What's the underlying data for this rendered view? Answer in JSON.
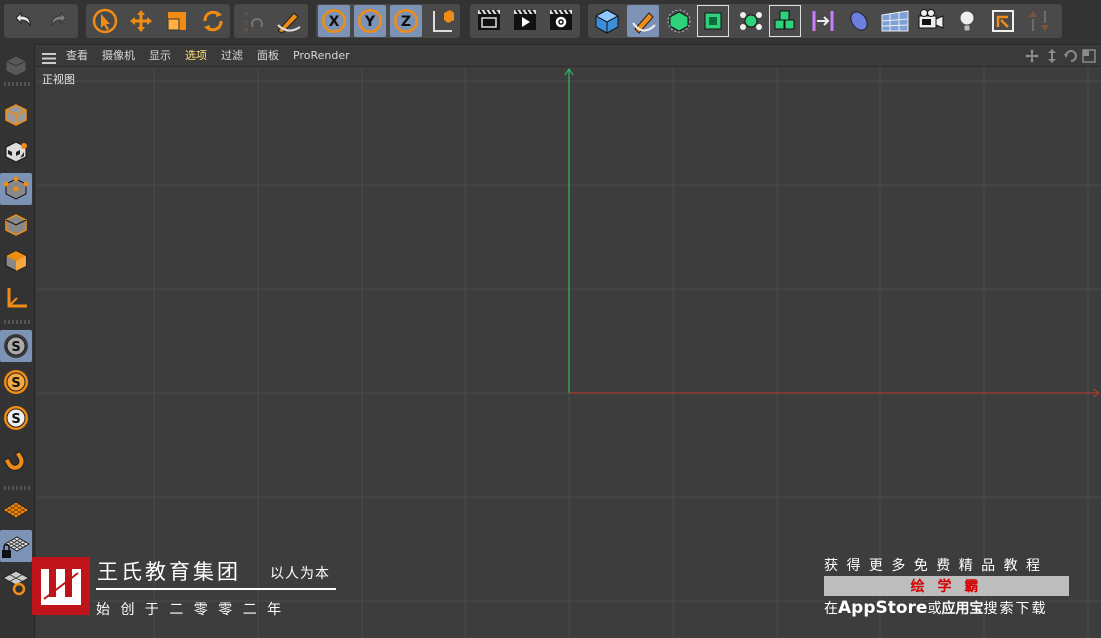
{
  "viewport_menu": {
    "items": [
      "查看",
      "摄像机",
      "显示",
      "选项",
      "过滤",
      "面板",
      "ProRender"
    ],
    "active_item": "选项",
    "view_name": "正视图"
  },
  "toolbar_icons": [
    "undo-icon",
    "redo-icon",
    "select-tool-icon",
    "move-tool-icon",
    "scale-tool-icon",
    "rotate-tool-icon",
    "psr-icon",
    "recent-tool-icon",
    "x-axis-icon",
    "y-axis-icon",
    "z-axis-icon",
    "coordinate-system-icon",
    "render-region-icon",
    "render-view-icon",
    "render-settings-icon",
    "cube-icon",
    "pen-icon",
    "subdivision-icon",
    "array-icon",
    "mograph-cloner-icon",
    "bend-deformer-icon",
    "capsule-icon",
    "floor-icon",
    "camera-icon",
    "light-icon",
    "scene-icon",
    "tag-icon"
  ],
  "watermark": {
    "company": "王氏教育集团",
    "slogan": "以人为本",
    "founded": "始 创 于 二 零 零 二 年",
    "promo_line": "获 得 更 多 免 费 精 品 教 程",
    "brand": "绘 学 霸",
    "store_prefix": "在",
    "store_app": "AppStore",
    "store_or": "或",
    "store_alt": "应用宝",
    "store_suffix": "搜索下载"
  },
  "colors": {
    "accent_orange": "#f08c14",
    "selected_blue": "#7d93b6",
    "axis_x": "#c0392b",
    "axis_y": "#2ecc71",
    "logo_red": "#c0141b",
    "brand_red": "#d40000"
  }
}
